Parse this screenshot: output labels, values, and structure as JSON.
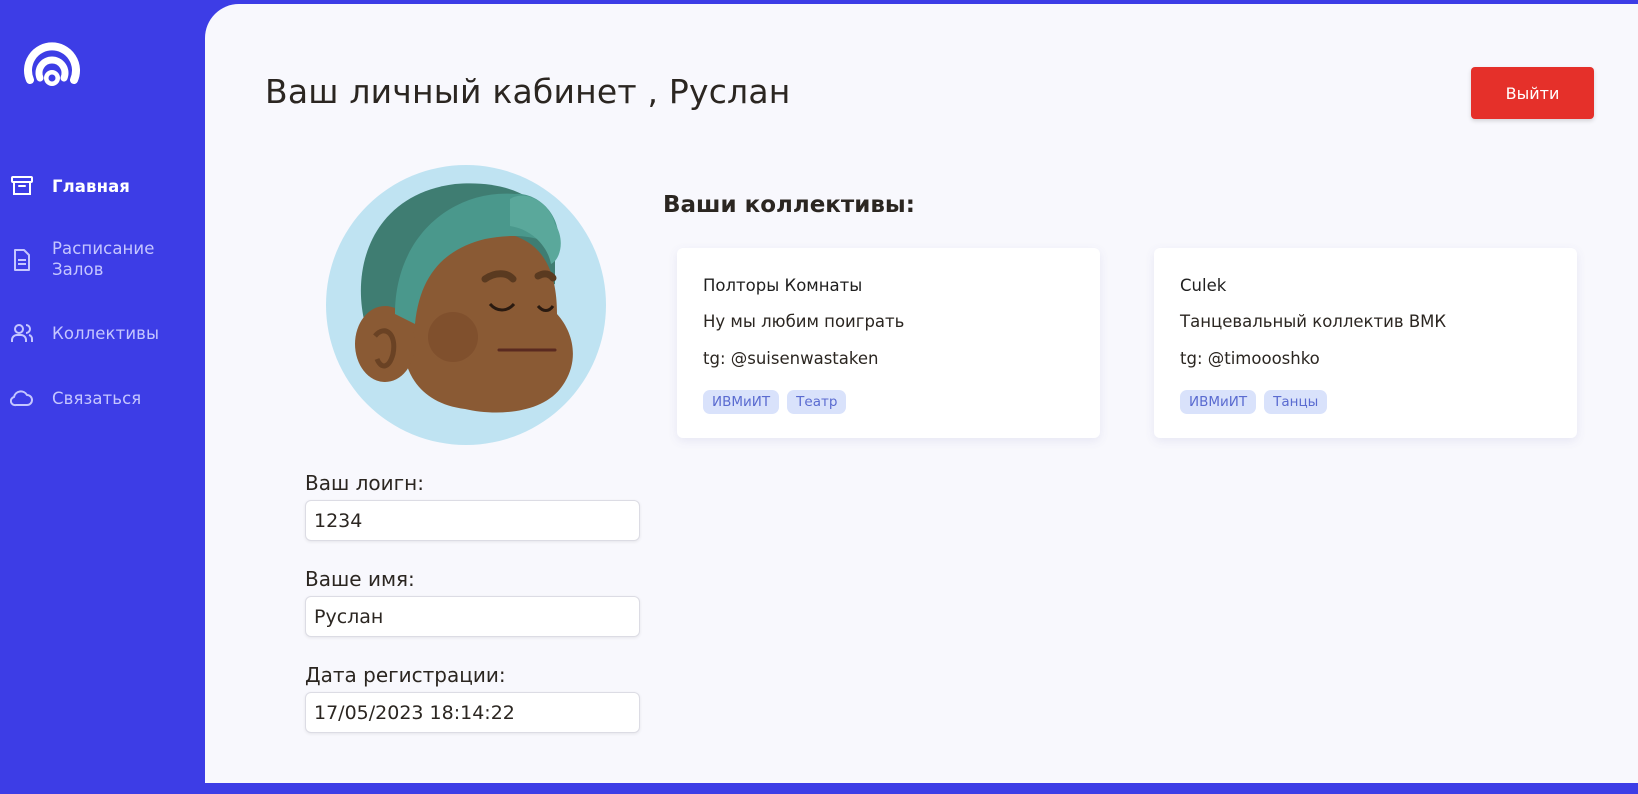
{
  "sidebar": {
    "items": [
      {
        "label": "Главная",
        "icon": "archive-icon",
        "active": true
      },
      {
        "label": "Расписание Залов",
        "icon": "document-icon",
        "active": false
      },
      {
        "label": "Коллективы",
        "icon": "users-icon",
        "active": false
      },
      {
        "label": "Связаться",
        "icon": "cloud-icon",
        "active": false
      }
    ]
  },
  "header": {
    "title": "Ваш личный кабинет , Руслан",
    "logout_label": "Выйти"
  },
  "profile": {
    "login_label": "Ваш лоигн:",
    "login_value": "1234",
    "name_label": "Ваше имя:",
    "name_value": "Руслан",
    "reg_label": "Дата регистрации:",
    "reg_value": "17/05/2023 18:14:22"
  },
  "collectives": {
    "title": "Ваши коллективы:",
    "items": [
      {
        "name": "Полторы Комнаты",
        "description": "Ну мы любим поиграть",
        "contact": "tg: @suisenwastaken",
        "tags": [
          "ИВМиИТ",
          "Театр"
        ]
      },
      {
        "name": "Culek",
        "description": "Танцевальный коллектив ВМК",
        "contact": "tg: @timoooshko",
        "tags": [
          "ИВМиИТ",
          "Танцы"
        ]
      }
    ]
  },
  "colors": {
    "brand": "#3d3de6",
    "danger": "#e5302a",
    "tag_bg": "#d9e2fb"
  }
}
